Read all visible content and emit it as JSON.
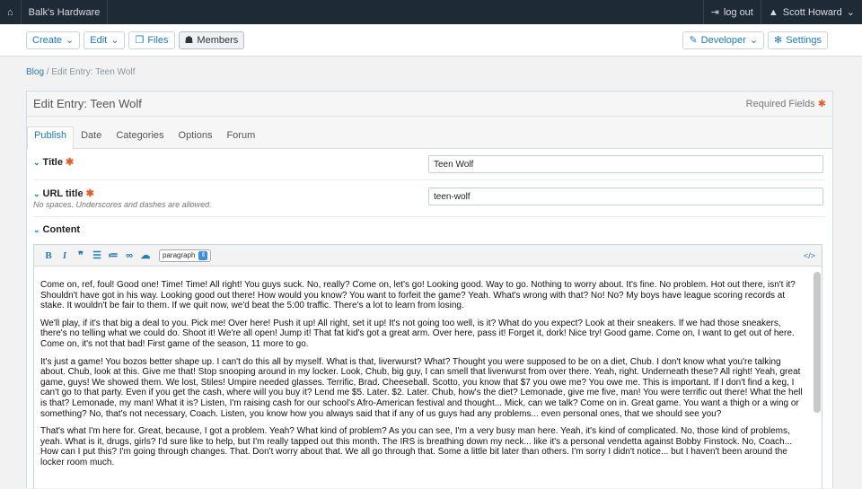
{
  "topbar": {
    "site": "Balk's Hardware",
    "logout": "log out",
    "user": "Scott Howard"
  },
  "toolbar": {
    "create": "Create",
    "edit": "Edit",
    "files": "Files",
    "members": "Members",
    "developer": "Developer",
    "settings": "Settings"
  },
  "breadcrumb": {
    "blog": "Blog",
    "current": "/ Edit Entry: Teen Wolf"
  },
  "panel": {
    "title": "Edit Entry: Teen Wolf",
    "required": "Required Fields"
  },
  "tabs": [
    "Publish",
    "Date",
    "Categories",
    "Options",
    "Forum"
  ],
  "fields": {
    "title_label": "Title",
    "title_value": "Teen Wolf",
    "url_label": "URL title",
    "url_value": "teen-wolf",
    "url_note": "No spaces. Underscores and dashes are allowed.",
    "content_label": "Content"
  },
  "editor": {
    "format": "paragraph",
    "paragraphs": [
      "Come on, ref, foul! Good one! Time! Time! All right! You guys suck. No, really? Come on, let's go! Looking good. Way to go. Nothing to worry about. It's fine. No problem. Hot out there, isn't it? Shouldn't have got in his way. Looking good out there! How would you know? You want to forfeit the game? Yeah. What's wrong with that? No! No? My boys have league scoring records at stake. It wouldn't be fair to them. If we quit now, we'd beat the 5:00 traffic. There's a lot to learn from losing.",
      "We'll play, if it's that big a deal to you. Pick me! Over here! Push it up! All right, set it up! It's not going too well, is it? What do you expect? Look at their sneakers. If we had those sneakers, there's no telling what we could do. Shoot it! We're all open! Jump it! That fat kid's got a great arm. Over here, pass it! Forget it, dork! Nice try! Good game. Come on, I want to get out of here. Come on, it's not that bad! First game of the season, 11 more to go.",
      "It's just a game! You bozos better shape up. I can't do this all by myself. What is that, liverwurst? What? Thought you were supposed to be on a diet, Chub. I don't know what you're talking about. Chub, look at this. Give me that! Stop snooping around in my locker. Look, Chub, big guy, I can smell that liverwurst from over there. Yeah, right. Underneath these? All right! Yeah, great game, guys! We showed them. We lost, Stiles! Umpire needed glasses. Terrific, Brad. Cheeseball. Scotto, you know that $7 you owe me? You owe me. This is important. If I don't find a keg, I can't go to that party. Even if you get the cash, where will you buy it? Lend me $5. Later. $2. Later. Chub, how's the diet? Lemonade, give me five, man! You were terrific out there! What the hell is that? Lemonade, my man! What it is? Listen, I'm raising cash for our school's Afro-American festival and thought... Mick, can we talk? Come on in. Great game. You want a thigh or a wing or something? No, that's not necessary, Coach. Listen, you know how you always said that if any of us guys had any problems... even personal ones, that we should see you?",
      "That's what I'm here for. Great, because, I got a problem. Yeah? What kind of problem? As you can see, I'm a very busy man here. Yeah, it's kind of complicated. No, those kind of problems, yeah. What is it, drugs, girls? I'd sure like to help, but I'm really tapped out this month. The IRS is breathing down my neck... like it's a personal vendetta against Bobby Finstock. No, Coach... How can I put this? I'm going through changes. That. Don't worry about that. We all go through that. Some a little bit later than others. I'm sorry I didn't notice... but I haven't been around the locker room much."
    ]
  }
}
